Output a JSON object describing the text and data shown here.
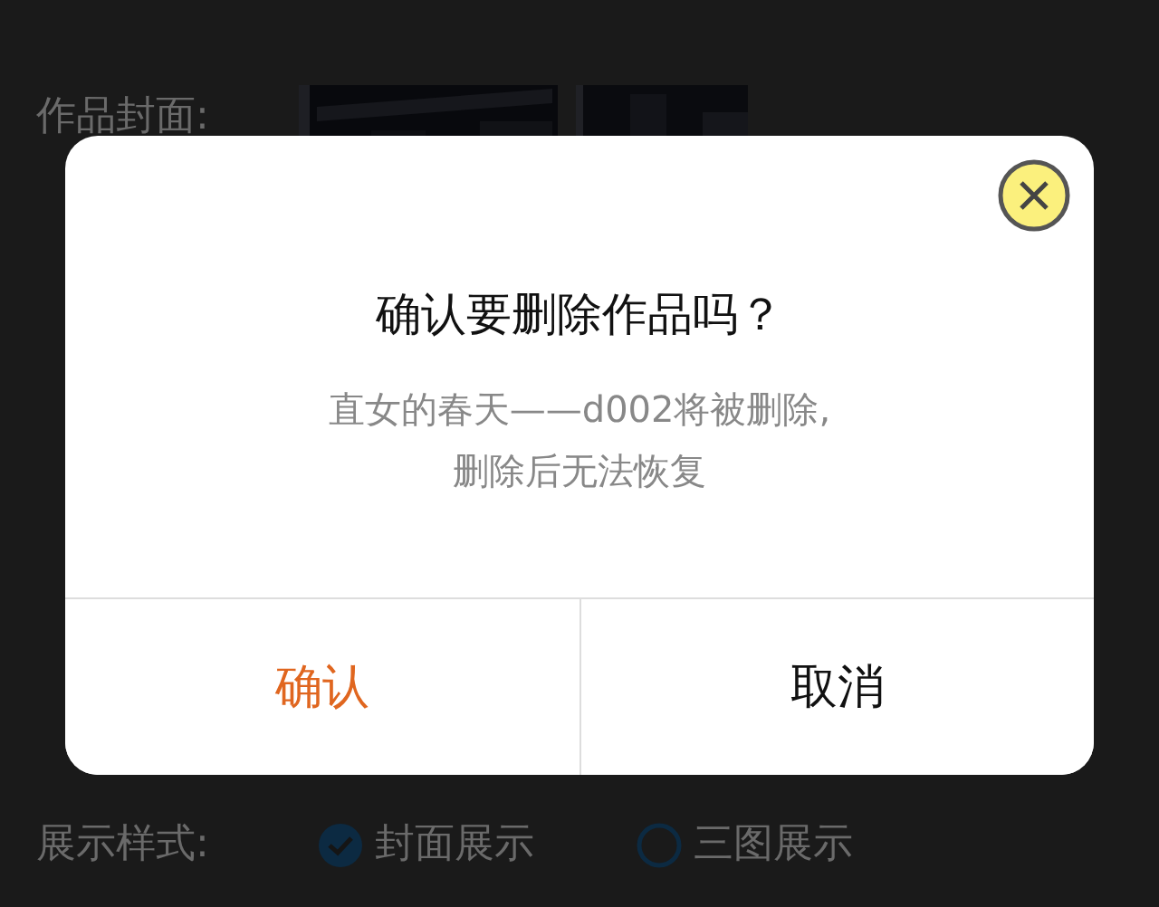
{
  "cover": {
    "label": "作品封面:"
  },
  "dialog": {
    "title": "确认要删除作品吗？",
    "message_lines": [
      "直女的春天——d002将被删除,",
      "删除后无法恢复"
    ],
    "buttons": [
      {
        "label": "确认",
        "kind": "primary"
      },
      {
        "label": "取消",
        "kind": "secondary"
      }
    ]
  },
  "display_style": {
    "label": "展示样式:",
    "options": [
      {
        "label": "封面展示",
        "selected": true
      },
      {
        "label": "三图展示",
        "selected": false
      }
    ]
  }
}
